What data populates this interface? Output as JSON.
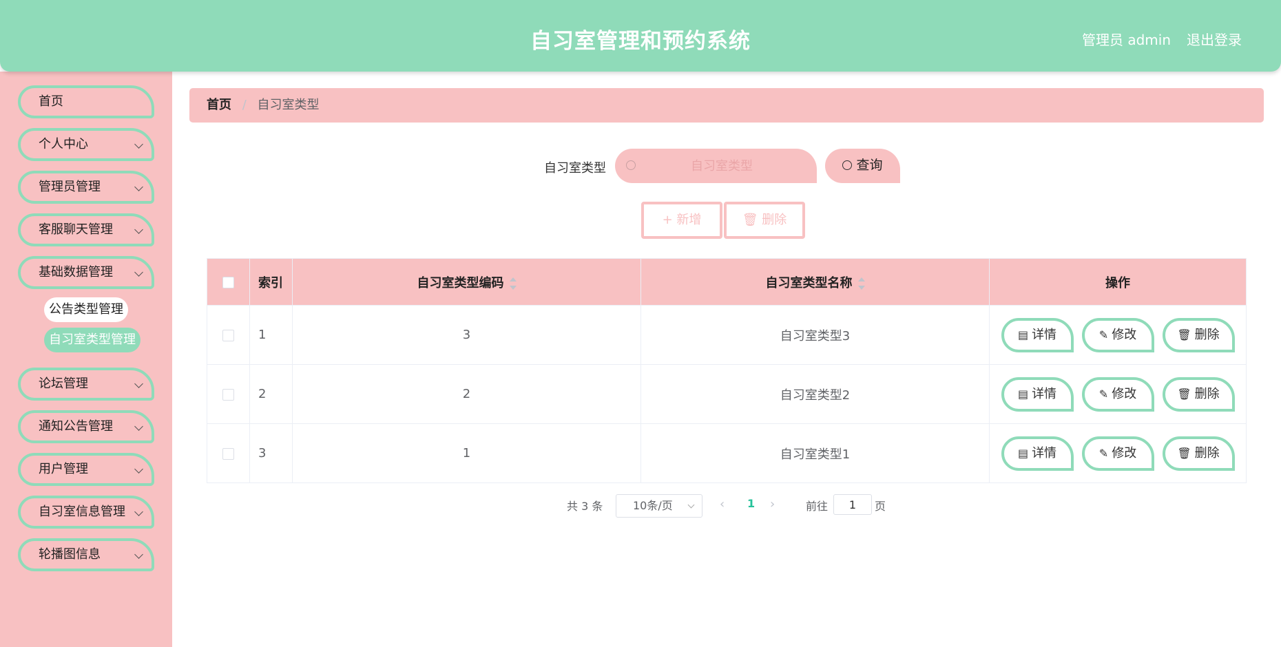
{
  "header": {
    "title": "自习室管理和预约系统",
    "user": "管理员 admin",
    "logout": "退出登录"
  },
  "sidebar": {
    "items": [
      {
        "label": "首页"
      },
      {
        "label": "个人中心"
      },
      {
        "label": "管理员管理"
      },
      {
        "label": "客服聊天管理"
      },
      {
        "label": "基础数据管理"
      },
      {
        "label": "论坛管理"
      },
      {
        "label": "通知公告管理"
      },
      {
        "label": "用户管理"
      },
      {
        "label": "自习室信息管理"
      },
      {
        "label": "轮播图信息"
      }
    ],
    "sub_items": [
      {
        "label": "公告类型管理"
      },
      {
        "label": "自习室类型管理"
      }
    ]
  },
  "breadcrumb": {
    "home": "首页",
    "separator": "/",
    "current": "自习室类型"
  },
  "search": {
    "label": "自习室类型",
    "placeholder": "自习室类型",
    "value": "",
    "query_button": "查询"
  },
  "actions": {
    "add": "新增",
    "delete": "删除"
  },
  "table": {
    "headers": {
      "index": "索引",
      "code": "自习室类型编码",
      "name": "自习室类型名称",
      "ops": "操作"
    },
    "rows": [
      {
        "index": "1",
        "code": "3",
        "name": "自习室类型3"
      },
      {
        "index": "2",
        "code": "2",
        "name": "自习室类型2"
      },
      {
        "index": "3",
        "code": "1",
        "name": "自习室类型1"
      }
    ],
    "row_buttons": {
      "detail": "详情",
      "edit": "修改",
      "delete": "删除"
    }
  },
  "pagination": {
    "total": "共 3 条",
    "page_size": "10条/页",
    "current_page": "1",
    "goto_label": "前往",
    "jump_value": "1",
    "page_unit": "页"
  },
  "colors": {
    "header_green": "#8fdbb9",
    "pink": "#f8c1c2",
    "active_page": "#26c29a"
  },
  "icons": {
    "search": "search-icon",
    "add": "plus-icon",
    "delete": "trash-icon",
    "detail": "document-icon",
    "edit": "pencil-icon",
    "chevron": "chevron-down-icon"
  }
}
